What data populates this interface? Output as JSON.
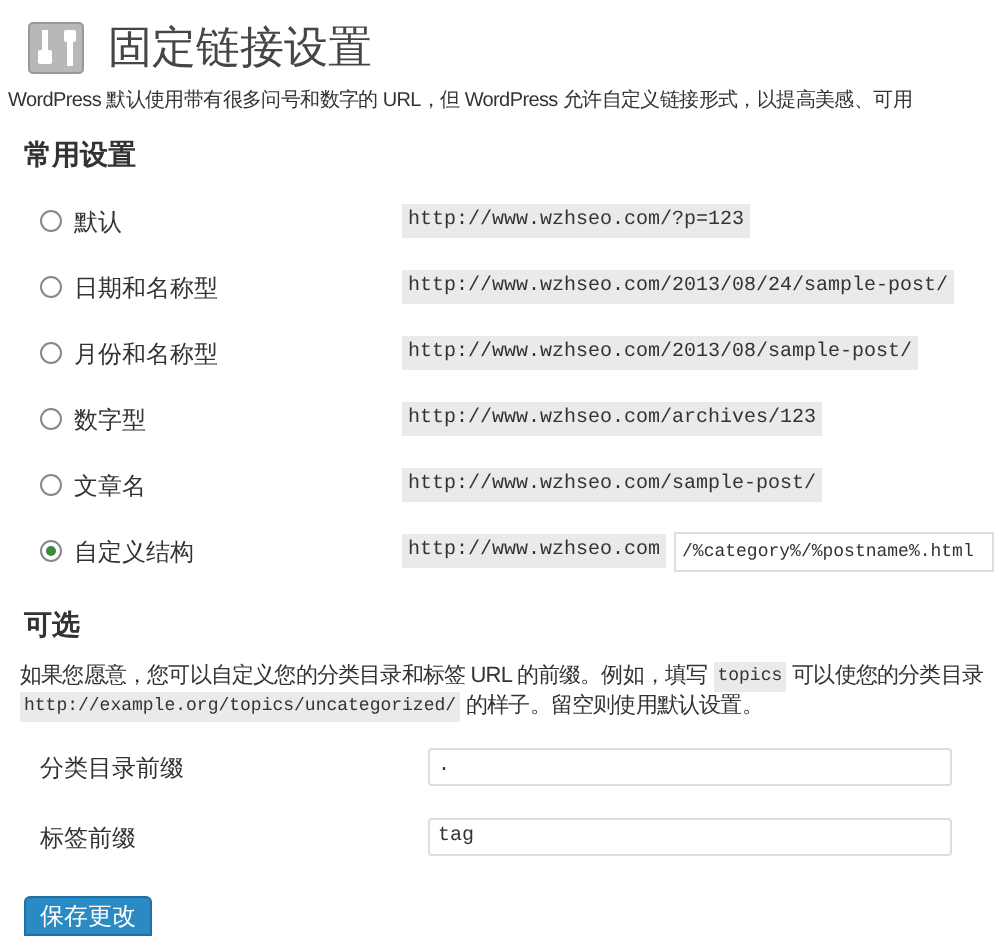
{
  "page_title": "固定链接设置",
  "intro": "WordPress 默认使用带有很多问号和数字的 URL，但 WordPress 允许自定义链接形式，以提高美感、可用",
  "common_settings": {
    "heading": "常用设置",
    "options": [
      {
        "label": "默认",
        "example": "http://www.wzhseo.com/?p=123",
        "selected": false,
        "kind": "example"
      },
      {
        "label": "日期和名称型",
        "example": "http://www.wzhseo.com/2013/08/24/sample-post/",
        "selected": false,
        "kind": "example"
      },
      {
        "label": "月份和名称型",
        "example": "http://www.wzhseo.com/2013/08/sample-post/",
        "selected": false,
        "kind": "example"
      },
      {
        "label": "数字型",
        "example": "http://www.wzhseo.com/archives/123",
        "selected": false,
        "kind": "example"
      },
      {
        "label": "文章名",
        "example": "http://www.wzhseo.com/sample-post/",
        "selected": false,
        "kind": "example"
      },
      {
        "label": "自定义结构",
        "example": "http://www.wzhseo.com",
        "selected": true,
        "kind": "custom",
        "value": "/%category%/%postname%.html"
      }
    ]
  },
  "optional": {
    "heading": "可选",
    "description": [
      [
        {
          "kind": "text",
          "text": "如果您愿意，您可以自定义您的分类目录和标签 URL 的前缀。例如，填写"
        },
        {
          "kind": "code",
          "text": "topics"
        },
        {
          "kind": "text",
          "text": "可以使您的分类目录"
        }
      ],
      [
        {
          "kind": "code",
          "text": "http://example.org/topics/uncategorized/"
        },
        {
          "kind": "text",
          "text": "的样子。留空则使用默认设置。"
        }
      ]
    ],
    "fields": [
      {
        "label": "分类目录前缀",
        "value": "."
      },
      {
        "label": "标签前缀",
        "value": "tag"
      }
    ]
  },
  "save_button": "保存更改"
}
